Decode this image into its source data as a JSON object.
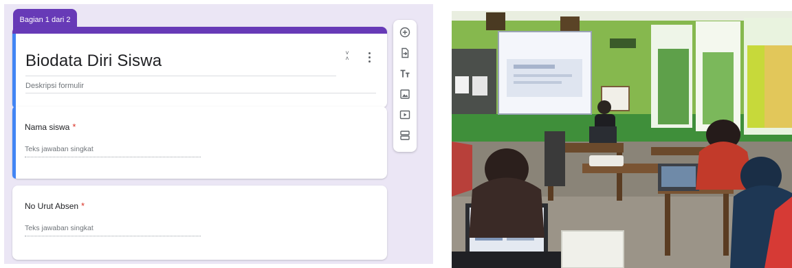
{
  "form": {
    "section_tab": "Bagian 1 dari 2",
    "title": "Biodata Diri Siswa",
    "description_placeholder": "Deskripsi formulir",
    "questions": [
      {
        "label": "Nama siswa",
        "required_mark": "*",
        "answer_placeholder": "Teks jawaban singkat"
      },
      {
        "label": "No Urut Absen",
        "required_mark": "*",
        "answer_placeholder": "Teks jawaban singkat"
      }
    ],
    "toolbar": {
      "items": [
        {
          "name": "add-question",
          "icon": "add-circle-icon"
        },
        {
          "name": "import-questions",
          "icon": "import-icon"
        },
        {
          "name": "add-title-description",
          "icon": "title-text-icon"
        },
        {
          "name": "add-image",
          "icon": "image-icon"
        },
        {
          "name": "add-video",
          "icon": "video-icon"
        },
        {
          "name": "add-section",
          "icon": "section-icon"
        }
      ]
    },
    "colors": {
      "theme": "#673ab7",
      "focus": "#4285f4",
      "background": "#ebe6f5",
      "required": "#d93025"
    }
  },
  "photo": {
    "subject": "classroom-workshop-photo"
  }
}
